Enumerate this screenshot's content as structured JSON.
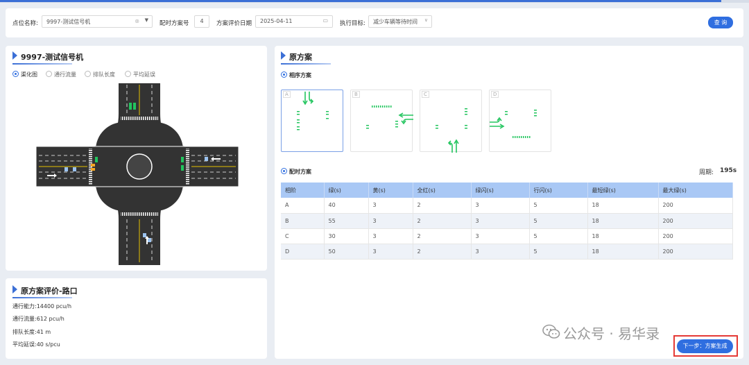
{
  "filter": {
    "point_label": "点位名称:",
    "point_value": "9997-测试信号机",
    "scheme_no_label": "配时方案号",
    "scheme_no_value": "4",
    "eval_date_label": "方案评价日期",
    "eval_date_value": "2025-04-11",
    "target_label": "执行目标:",
    "target_value": "减少车辆等待时间",
    "query_button": "查 询"
  },
  "left_panel": {
    "title": "9997-测试信号机",
    "view_options": [
      "渠化图",
      "通行流量",
      "排队长度",
      "平均延误"
    ],
    "selected_view": 0
  },
  "eval_panel": {
    "title": "原方案评价-路口",
    "metrics": [
      {
        "label": "通行能力:",
        "value": "14400 pcu/h"
      },
      {
        "label": "通行流量:",
        "value": "612 pcu/h"
      },
      {
        "label": "排队长度:",
        "value": "41 m"
      },
      {
        "label": "平均延误:",
        "value": "40 s/pcu"
      }
    ]
  },
  "right_panel": {
    "title": "原方案",
    "phase_section": "相序方案",
    "phases": [
      "A",
      "B",
      "C",
      "D"
    ],
    "timing_section": "配时方案",
    "cycle_label": "周期:",
    "cycle_value": "195s",
    "table": {
      "headers": [
        "相阶",
        "绿(s)",
        "黄(s)",
        "全红(s)",
        "绿闪(s)",
        "行闪(s)",
        "最短绿(s)",
        "最大绿(s)"
      ],
      "rows": [
        [
          "A",
          "40",
          "3",
          "2",
          "3",
          "5",
          "18",
          "200"
        ],
        [
          "B",
          "55",
          "3",
          "2",
          "3",
          "5",
          "18",
          "200"
        ],
        [
          "C",
          "30",
          "3",
          "2",
          "3",
          "5",
          "18",
          "200"
        ],
        [
          "D",
          "50",
          "3",
          "2",
          "3",
          "5",
          "18",
          "200"
        ]
      ]
    }
  },
  "next_button": "下一步：方案生成",
  "watermark": "公众号 · 易华录",
  "colors": {
    "accent": "#2f6ee0",
    "signal_green": "#22c55e",
    "road": "#333333"
  }
}
